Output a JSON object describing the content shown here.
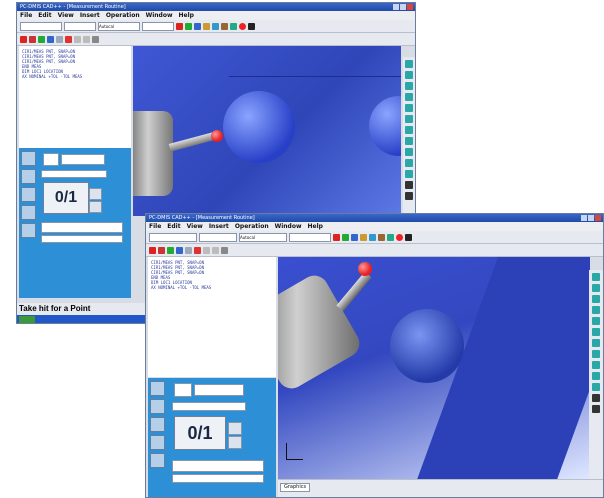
{
  "window_back": {
    "title": "PC-DMIS CAD++ - [Measurement Routine]",
    "menu": [
      "File",
      "Edit",
      "View",
      "Insert",
      "Operation",
      "Window",
      "Help"
    ],
    "toolbar_combo": "Autocal",
    "edit_window_lines": [
      "CIR1/MEAS PNT, SNAP=ON",
      "CIR1/MEAS PNT, SNAP=ON",
      "CIR1/MEAS PNT, SNAP=ON",
      "END MEAS",
      "DIM LOC1 LOCATION",
      "AX NOMINAL +TOL -TOL MEAS"
    ],
    "probe_toolbox": {
      "counter": "0/1"
    },
    "status_text": "Take hit for a Point",
    "accent_colors": {
      "viewport": "#3f57d4",
      "probe_tip": "#e82020",
      "panel": "#2d8fd6"
    }
  },
  "window_front": {
    "title": "PC-DMIS CAD++ - [Measurement Routine]",
    "menu": [
      "File",
      "Edit",
      "View",
      "Insert",
      "Operation",
      "Window",
      "Help"
    ],
    "toolbar_combo": "Autocal",
    "edit_window_lines": [
      "CIR1/MEAS PNT, SNAP=ON",
      "CIR1/MEAS PNT, SNAP=ON",
      "CIR1/MEAS PNT, SNAP=ON",
      "END MEAS",
      "DIM LOC1 LOCATION",
      "AX NOMINAL +TOL -TOL MEAS"
    ],
    "probe_toolbox": {
      "counter": "0/1"
    },
    "tab_label": "Graphics"
  },
  "icons": [
    "probe-icon",
    "measure-icon",
    "plane-icon",
    "circle-icon",
    "cylinder-icon",
    "save-icon",
    "print-icon",
    "rotate-icon"
  ]
}
